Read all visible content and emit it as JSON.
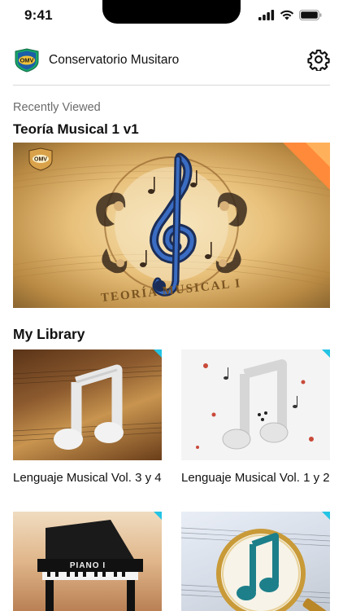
{
  "status_bar": {
    "time": "9:41",
    "icons": [
      "cellular-signal-icon",
      "wifi-icon",
      "battery-icon"
    ]
  },
  "header": {
    "logo_text": "OMV",
    "title": "Conservatorio Musitaro",
    "settings_icon": "gear-icon"
  },
  "recent": {
    "section_label": "Recently Viewed",
    "title": "Teoría Musical 1 v1",
    "hero_caption": "TEORÍA MUSICAL I"
  },
  "library": {
    "section_label": "My Library",
    "items": [
      {
        "title": "Lenguaje Musical Vol. 3 y 4"
      },
      {
        "title": "Lenguaje Musical Vol. 1 y 2"
      },
      {
        "title": "",
        "thumb_text": "PIANO I"
      },
      {
        "title": ""
      }
    ]
  },
  "colors": {
    "accent_corner": "#23c4e4",
    "hero_corner": "#ff8a3a",
    "logo_green": "#19a56b",
    "logo_blue": "#1c5ea8"
  }
}
